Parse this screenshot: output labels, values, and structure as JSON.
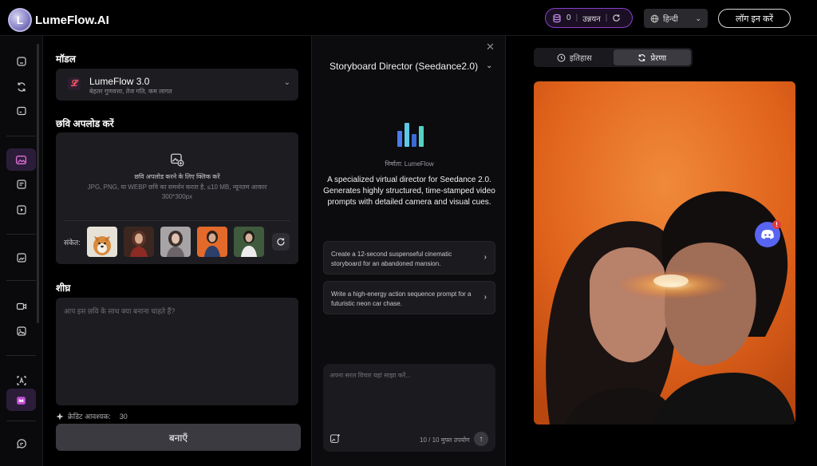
{
  "app": {
    "logo_text": "LumeFlow.AI"
  },
  "topbar": {
    "credits_value": "0",
    "upgrade_label": "उन्नयन",
    "language": "हिन्दी",
    "login_label": "लॉग इन करें"
  },
  "model": {
    "section_title": "मॉडल",
    "name": "LumeFlow 3.0",
    "description": "बेहतर गुणवत्ता, तेज गति, कम लागत"
  },
  "upload": {
    "section_title": "छवि अपलोड करें",
    "click_text": "छवि अपलोड करने के लिए क्लिक करें",
    "requirements": "JPG, PNG, या WEBP छवि का समर्थन करता है, ≤10 MB, न्यूनतम आकार 300*300px",
    "hint_label": "संकेत:"
  },
  "prompt": {
    "section_title": "शीघ्र",
    "placeholder": "आप इस छवि के साथ क्या बनाना चाहते हैं?",
    "credits_label": "क्रेडिट आवश्यक:",
    "credits_value": "30",
    "create_label": "बनाएँ"
  },
  "agent": {
    "title": "Storyboard Director (Seedance2.0)",
    "creator": "निर्माता: LumeFlow",
    "description": "A specialized virtual director for Seedance 2.0. Generates highly structured, time-stamped video prompts with detailed camera and visual cues.",
    "suggestions": [
      "Create a 12-second suspenseful cinematic storyboard for an abandoned mansion.",
      "Write a high-energy action sequence prompt for a futuristic neon car chase."
    ],
    "input_placeholder": "अपना सरल विचार यहां साझा करें...",
    "usage": "10 / 10 मुफ्त उपयोग"
  },
  "gallery": {
    "tabs": [
      "इतिहास",
      "प्रेरणा"
    ],
    "active_tab": "प्रेरणा"
  },
  "discord": {
    "badge": "!"
  },
  "colors": {
    "accent_purple": "#8b3fc8",
    "discord_blue": "#5865f2",
    "hero_orange": "#e8681c"
  }
}
